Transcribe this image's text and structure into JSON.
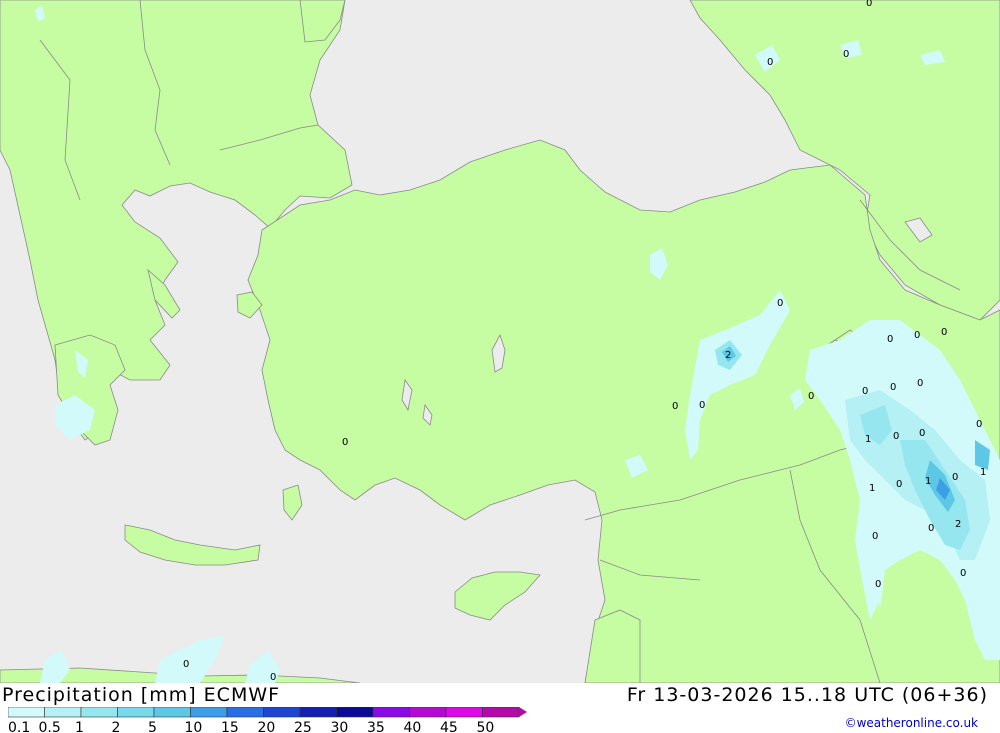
{
  "header": {
    "title": "Precipitation [mm] ECMWF",
    "datetime": "Fr 13-03-2026 15..18 UTC (06+36)",
    "credit": "©weatheronline.co.uk"
  },
  "colors": {
    "sea": "#ececec",
    "land": "#c6fca2",
    "border": "#8a8a8a",
    "precip_light": "#d2fafa",
    "precip_mid": "#96e6f0",
    "precip_heavy": "#5cc8e6",
    "precip_max": "#3c9ee6"
  },
  "legend": {
    "items": [
      {
        "label": "0.1",
        "color": "#d2fafa"
      },
      {
        "label": "0.5",
        "color": "#b4f0f4"
      },
      {
        "label": "1",
        "color": "#96e6f0"
      },
      {
        "label": "2",
        "color": "#78d8ec"
      },
      {
        "label": "5",
        "color": "#5cc8e6"
      },
      {
        "label": "10",
        "color": "#3c9ee6"
      },
      {
        "label": "15",
        "color": "#2a6ee4"
      },
      {
        "label": "20",
        "color": "#1e46d2"
      },
      {
        "label": "25",
        "color": "#1420b4"
      },
      {
        "label": "30",
        "color": "#0a0a96"
      },
      {
        "label": "35",
        "color": "#8c0ae6"
      },
      {
        "label": "40",
        "color": "#b40ad2"
      },
      {
        "label": "45",
        "color": "#dc0ae6"
      },
      {
        "label": "50",
        "color": "#b40aaa"
      }
    ]
  },
  "map_values": [
    "0",
    "0",
    "0",
    "0",
    "2",
    "0",
    "0",
    "0",
    "0",
    "0",
    "0",
    "0",
    "0",
    "0",
    "1",
    "0",
    "0",
    "1",
    "0",
    "1",
    "0",
    "0",
    "1",
    "0",
    "2",
    "0",
    "0",
    "0",
    "0",
    "0",
    "0"
  ]
}
